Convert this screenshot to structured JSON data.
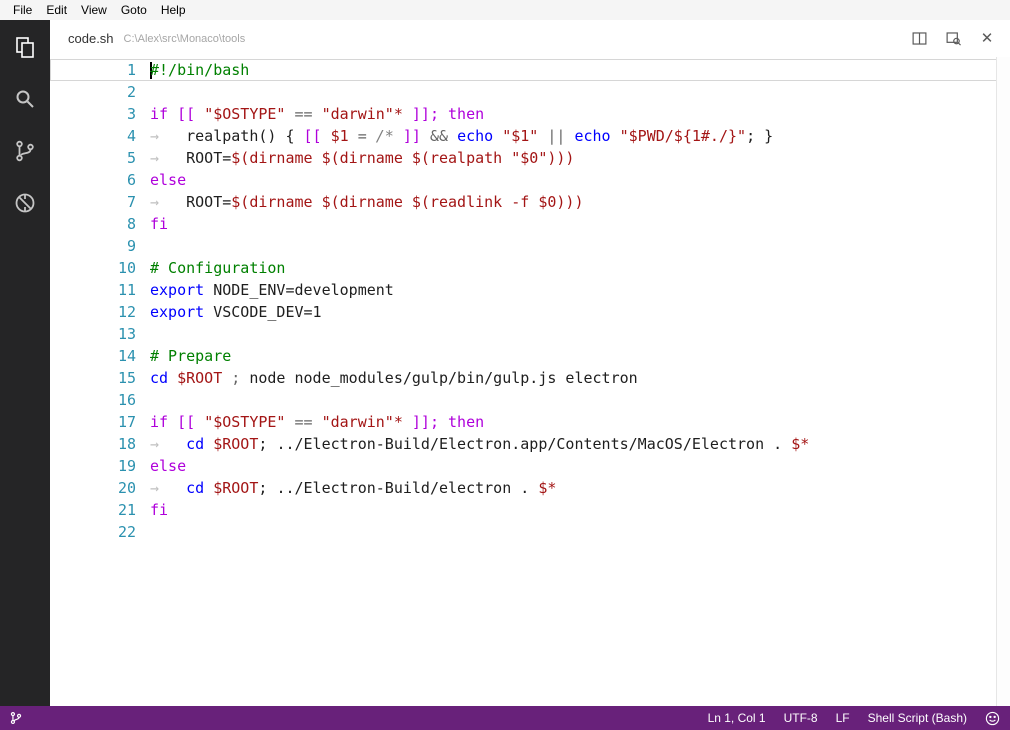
{
  "menu": {
    "items": [
      "File",
      "Edit",
      "View",
      "Goto",
      "Help"
    ]
  },
  "activity_bar": {
    "icons": [
      "explorer",
      "search",
      "git",
      "debug"
    ],
    "active": "explorer"
  },
  "tab_bar": {
    "file_name": "code.sh",
    "file_path": "C:\\Alex\\src\\Monaco\\tools",
    "actions": [
      "split-editor",
      "open-preview",
      "close"
    ]
  },
  "editor": {
    "cursor": "Ln 1, Col 1",
    "lines": [
      {
        "n": "1",
        "current": true,
        "tokens": [
          [
            "#!/bin/bash",
            "cm"
          ]
        ]
      },
      {
        "n": "2",
        "tokens": []
      },
      {
        "n": "3",
        "tokens": [
          [
            "if [[ ",
            "ctl"
          ],
          [
            "\"$OSTYPE\"",
            "str"
          ],
          [
            " == ",
            "op"
          ],
          [
            "\"darwin\"*",
            "str"
          ],
          [
            " ]]; ",
            "ctl"
          ],
          [
            "then",
            "ctl"
          ]
        ]
      },
      {
        "n": "4",
        "tokens": [
          [
            "→   ",
            "ws"
          ],
          [
            "realpath() { ",
            "pl"
          ],
          [
            "[[ ",
            "ctl"
          ],
          [
            "$1",
            "str"
          ],
          [
            " = ",
            "op"
          ],
          [
            "/*",
            "glob"
          ],
          [
            " ]]",
            "ctl"
          ],
          [
            " && ",
            "op"
          ],
          [
            "echo",
            "kw"
          ],
          [
            " ",
            "pl"
          ],
          [
            "\"$1\"",
            "str"
          ],
          [
            " ",
            "pl"
          ],
          [
            "|| ",
            "op"
          ],
          [
            "echo",
            "kw"
          ],
          [
            " ",
            "pl"
          ],
          [
            "\"$PWD/${1#./}\"",
            "str"
          ],
          [
            "; }",
            "pl"
          ]
        ]
      },
      {
        "n": "5",
        "tokens": [
          [
            "→   ",
            "ws"
          ],
          [
            "ROOT=",
            "pl"
          ],
          [
            "$(dirname $(dirname $(realpath \"$0\")))",
            "str"
          ]
        ]
      },
      {
        "n": "6",
        "tokens": [
          [
            "else",
            "ctl"
          ]
        ]
      },
      {
        "n": "7",
        "tokens": [
          [
            "→   ",
            "ws"
          ],
          [
            "ROOT=",
            "pl"
          ],
          [
            "$(dirname $(dirname $(readlink -f $0)))",
            "str"
          ]
        ]
      },
      {
        "n": "8",
        "tokens": [
          [
            "fi",
            "ctl"
          ]
        ]
      },
      {
        "n": "9",
        "tokens": []
      },
      {
        "n": "10",
        "tokens": [
          [
            "# Configuration",
            "cm"
          ]
        ]
      },
      {
        "n": "11",
        "tokens": [
          [
            "export",
            "kw"
          ],
          [
            " NODE_ENV=development",
            "pl"
          ]
        ]
      },
      {
        "n": "12",
        "tokens": [
          [
            "export",
            "kw"
          ],
          [
            " VSCODE_DEV=1",
            "pl"
          ]
        ]
      },
      {
        "n": "13",
        "tokens": []
      },
      {
        "n": "14",
        "tokens": [
          [
            "# Prepare",
            "cm"
          ]
        ]
      },
      {
        "n": "15",
        "tokens": [
          [
            "cd",
            "kw"
          ],
          [
            " ",
            "pl"
          ],
          [
            "$ROOT",
            "str"
          ],
          [
            " ; ",
            "op"
          ],
          [
            "node node_modules/gulp/bin/gulp.js electron",
            "pl"
          ]
        ]
      },
      {
        "n": "16",
        "tokens": []
      },
      {
        "n": "17",
        "tokens": [
          [
            "if [[ ",
            "ctl"
          ],
          [
            "\"$OSTYPE\"",
            "str"
          ],
          [
            " == ",
            "op"
          ],
          [
            "\"darwin\"*",
            "str"
          ],
          [
            " ]]; ",
            "ctl"
          ],
          [
            "then",
            "ctl"
          ]
        ]
      },
      {
        "n": "18",
        "tokens": [
          [
            "→   ",
            "ws"
          ],
          [
            "cd",
            "kw"
          ],
          [
            " ",
            "pl"
          ],
          [
            "$ROOT",
            "str"
          ],
          [
            "; ",
            "pl"
          ],
          [
            "../Electron-Build/Electron.app/Contents/MacOS/Electron . ",
            "pl"
          ],
          [
            "$*",
            "str"
          ]
        ]
      },
      {
        "n": "19",
        "tokens": [
          [
            "else",
            "ctl"
          ]
        ]
      },
      {
        "n": "20",
        "tokens": [
          [
            "→   ",
            "ws"
          ],
          [
            "cd",
            "kw"
          ],
          [
            " ",
            "pl"
          ],
          [
            "$ROOT",
            "str"
          ],
          [
            "; ",
            "pl"
          ],
          [
            "../Electron-Build/electron . ",
            "pl"
          ],
          [
            "$*",
            "str"
          ]
        ]
      },
      {
        "n": "21",
        "tokens": [
          [
            "fi",
            "ctl"
          ]
        ]
      },
      {
        "n": "22",
        "tokens": []
      }
    ]
  },
  "status_bar": {
    "left_icon": "git-branch",
    "items": [
      {
        "name": "cursor-position",
        "label": "Ln 1, Col 1"
      },
      {
        "name": "encoding",
        "label": "UTF-8"
      },
      {
        "name": "eol",
        "label": "LF"
      },
      {
        "name": "language-mode",
        "label": "Shell Script (Bash)"
      }
    ],
    "right_icon": "feedback-smiley"
  },
  "colors": {
    "status_bar_bg": "#68217A",
    "activity_bar_bg": "#252526",
    "comment": "#008000",
    "keyword": "#0000FF",
    "control_keyword": "#AF00DB",
    "string": "#A31515",
    "line_number": "#2B91AF",
    "cursor": "#000000"
  }
}
